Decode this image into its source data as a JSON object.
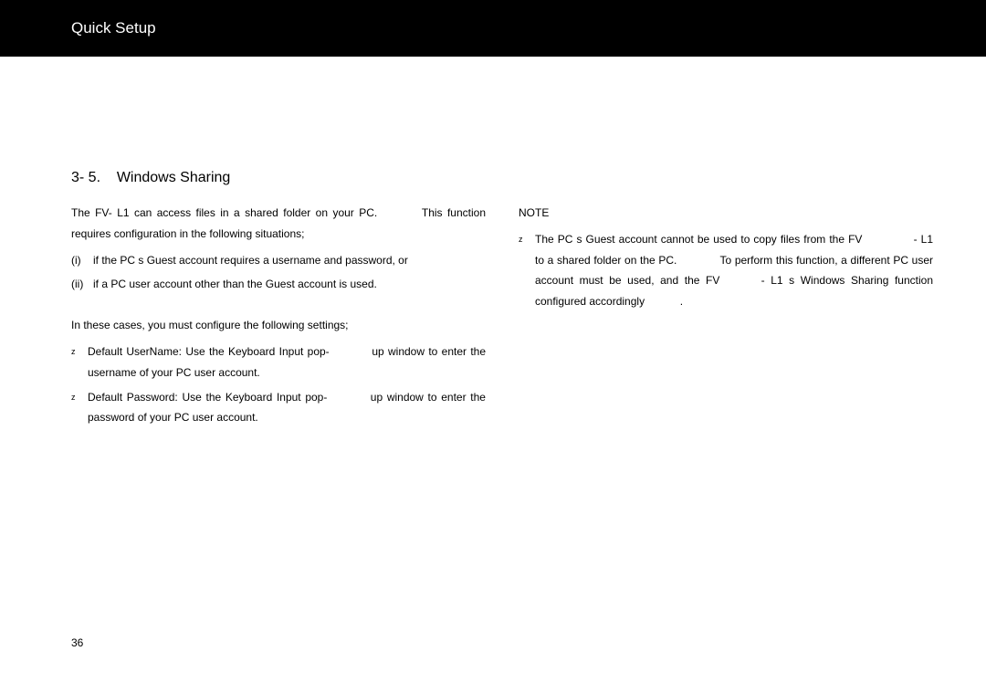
{
  "header": {
    "title": "Quick Setup"
  },
  "section": {
    "number": "3- 5.",
    "title": "Windows Sharing"
  },
  "left": {
    "intro_a": "The  FV- L1  can access files in a shared folder on your PC.",
    "intro_b": "This function requires configuration in the following situations;",
    "item_i_marker": "(i)",
    "item_i": "if the PC s  Guest  account requires a username and password, or",
    "item_ii_marker": "(ii)",
    "item_ii": "if a  PC user account other than the  Guest  account is used.",
    "mid": "In these cases, you must configure the following settings;",
    "b1_a": "Default UserName: Use the  Keyboard Input  pop-",
    "b1_b": "up window to enter the username of your PC user account.",
    "b2_a": "Default Password: Use the  Keyboard Input  pop-",
    "b2_b": "up window to enter the password of your PC user account."
  },
  "right": {
    "note": "NOTE",
    "n1": "The PC s  Guest  account cannot be used to copy files from the FV",
    "n2": "- L1 to a shared folder on the PC.",
    "n3": "To perform this function, a different PC user  account  must  be  used,  and  the  FV",
    "n4": "- L1 s   Windows  Sharing function configured accordingly",
    "n5": "."
  },
  "page_number": "36"
}
